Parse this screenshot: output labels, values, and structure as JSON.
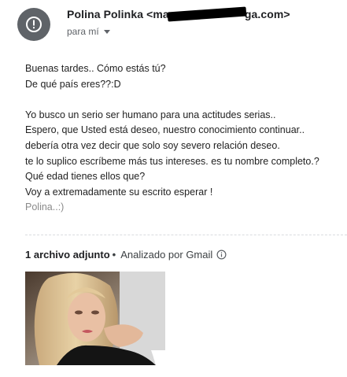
{
  "header": {
    "sender_name": "Polina Polinka",
    "sender_email_prefix": "<ma",
    "sender_email_suffix": "ga.com>",
    "recipient_label": "para mí"
  },
  "message": {
    "lines": [
      "Buenas tardes.. Cómo estás tú?",
      "De qué país eres??:D",
      "",
      "Yo busco un serio ser humano para una actitudes serias..",
      "Espero, que Usted está deseo, nuestro conocimiento continuar..",
      "debería otra vez decir que solo soy severo relación deseo.",
      "te lo suplico escríbeme más tus intereses. es tu nombre completo.?",
      "Qué edad tienes ellos que?",
      "Voy a extremadamente su escrito esperar !"
    ],
    "signature": "Polina..:)"
  },
  "attachments": {
    "count_label": "1 archivo adjunto",
    "separator": "•",
    "scan_label": "Analizado por Gmail"
  },
  "icons": {
    "avatar": "alert-circle-icon",
    "recipient_dropdown": "caret-down-icon",
    "info": "info-icon"
  },
  "colors": {
    "avatar_bg": "#5f6368",
    "text": "#202124",
    "muted": "#5f6368"
  }
}
